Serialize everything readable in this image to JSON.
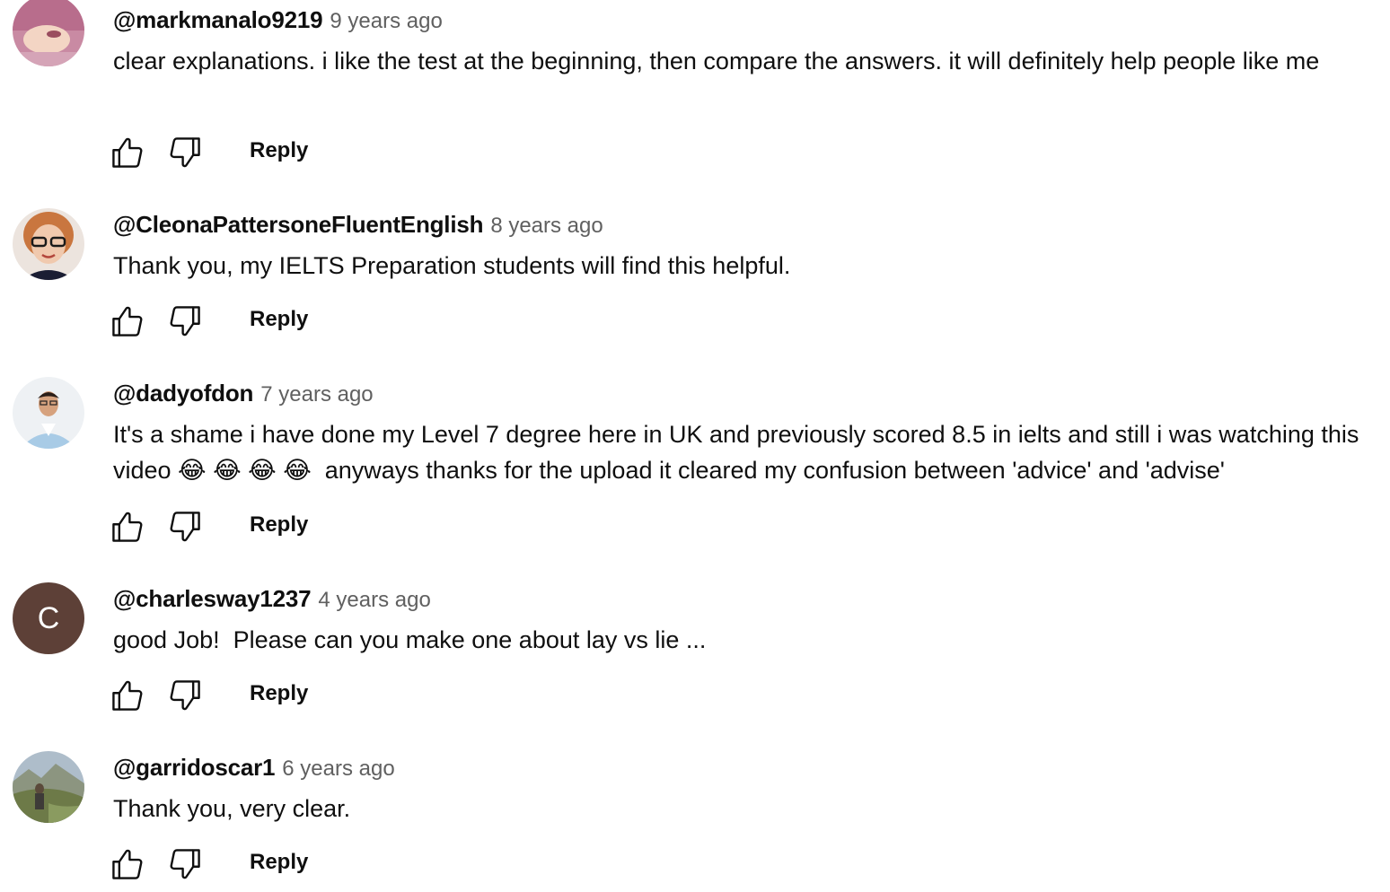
{
  "comments": [
    {
      "author": "@markmanalo9219",
      "time": "9 years ago",
      "text": "clear explanations. i like the test at the beginning, then compare the answers. it will definitely help people like me",
      "reply_label": "Reply",
      "avatar": {
        "type": "photo",
        "colors": [
          "#d7a3b6",
          "#f4d9c6",
          "#b05f7a"
        ]
      }
    },
    {
      "author": "@CleonaPattersoneFluentEnglish",
      "time": "8 years ago",
      "text": "Thank you, my IELTS Preparation students will find this helpful.",
      "reply_label": "Reply",
      "avatar": {
        "type": "photo",
        "colors": [
          "#e8d0c0",
          "#c06a3a",
          "#1b1b2b"
        ]
      }
    },
    {
      "author": "@dadyofdon",
      "time": "7 years ago",
      "text": "It's a shame i have done my Level 7 degree here in UK and previously scored 8.5 in ielts and still i was watching this video 😂 😂 😂 😂  anyways thanks for the upload it cleared my confusion between 'advice' and 'advise'",
      "reply_label": "Reply",
      "avatar": {
        "type": "photo",
        "colors": [
          "#e9eef2",
          "#9ec4e4",
          "#3a2a22"
        ]
      }
    },
    {
      "author": "@charlesway1237",
      "time": "4 years ago",
      "text": "good Job!  Please can you make one about lay vs lie ...",
      "reply_label": "Reply",
      "avatar": {
        "type": "letter",
        "letter": "C",
        "color": "#5d4037"
      }
    },
    {
      "author": "@garridoscar1",
      "time": "6 years ago",
      "text": "Thank you, very clear.",
      "reply_label": "Reply",
      "avatar": {
        "type": "photo",
        "colors": [
          "#a7b6c2",
          "#6e7d52",
          "#4a4336"
        ]
      }
    }
  ]
}
